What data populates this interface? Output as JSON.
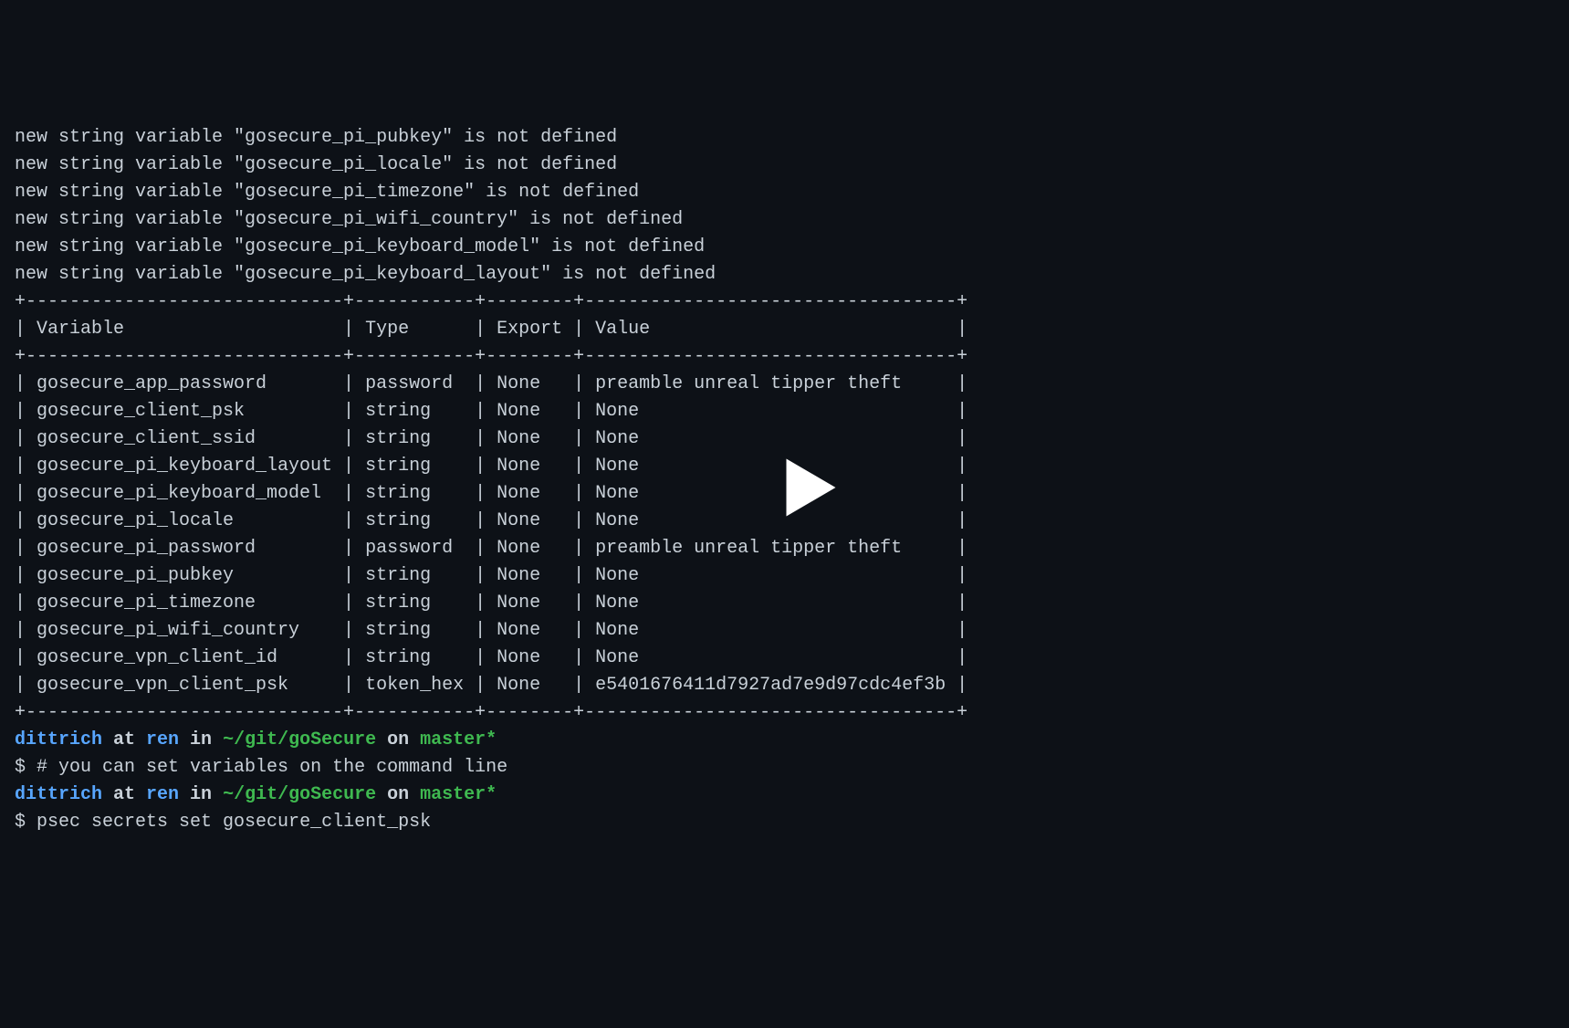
{
  "warnings": [
    "new string variable \"gosecure_pi_pubkey\" is not defined",
    "new string variable \"gosecure_pi_locale\" is not defined",
    "new string variable \"gosecure_pi_timezone\" is not defined",
    "new string variable \"gosecure_pi_wifi_country\" is not defined",
    "new string variable \"gosecure_pi_keyboard_model\" is not defined",
    "new string variable \"gosecure_pi_keyboard_layout\" is not defined"
  ],
  "table": {
    "border_top": "+-----------------------------+-----------+--------+----------------------------------+",
    "header_row": "| Variable                    | Type      | Export | Value                            |",
    "border_mid": "+-----------------------------+-----------+--------+----------------------------------+",
    "rows": [
      "| gosecure_app_password       | password  | None   | preamble unreal tipper theft     |",
      "| gosecure_client_psk         | string    | None   | None                             |",
      "| gosecure_client_ssid        | string    | None   | None                             |",
      "| gosecure_pi_keyboard_layout | string    | None   | None                             |",
      "| gosecure_pi_keyboard_model  | string    | None   | None                             |",
      "| gosecure_pi_locale          | string    | None   | None                             |",
      "| gosecure_pi_password        | password  | None   | preamble unreal tipper theft     |",
      "| gosecure_pi_pubkey          | string    | None   | None                             |",
      "| gosecure_pi_timezone        | string    | None   | None                             |",
      "| gosecure_pi_wifi_country    | string    | None   | None                             |",
      "| gosecure_vpn_client_id      | string    | None   | None                             |",
      "| gosecure_vpn_client_psk     | token_hex | None   | e5401676411d7927ad7e9d97cdc4ef3b |"
    ],
    "border_bot": "+-----------------------------+-----------+--------+----------------------------------+"
  },
  "prompt1": {
    "user": "dittrich",
    "at": " at ",
    "host": "ren",
    "in": " in ",
    "path": "~/git/goSecure",
    "on": " on ",
    "branch": "master*"
  },
  "command1": {
    "dollar": "$ ",
    "text": "# you can set variables on the command line"
  },
  "prompt2": {
    "user": "dittrich",
    "at": " at ",
    "host": "ren",
    "in": " in ",
    "path": "~/git/goSecure",
    "on": " on ",
    "branch": "master*"
  },
  "command2": {
    "dollar": "$ ",
    "text": "psec secrets set gosecure_client_psk"
  }
}
